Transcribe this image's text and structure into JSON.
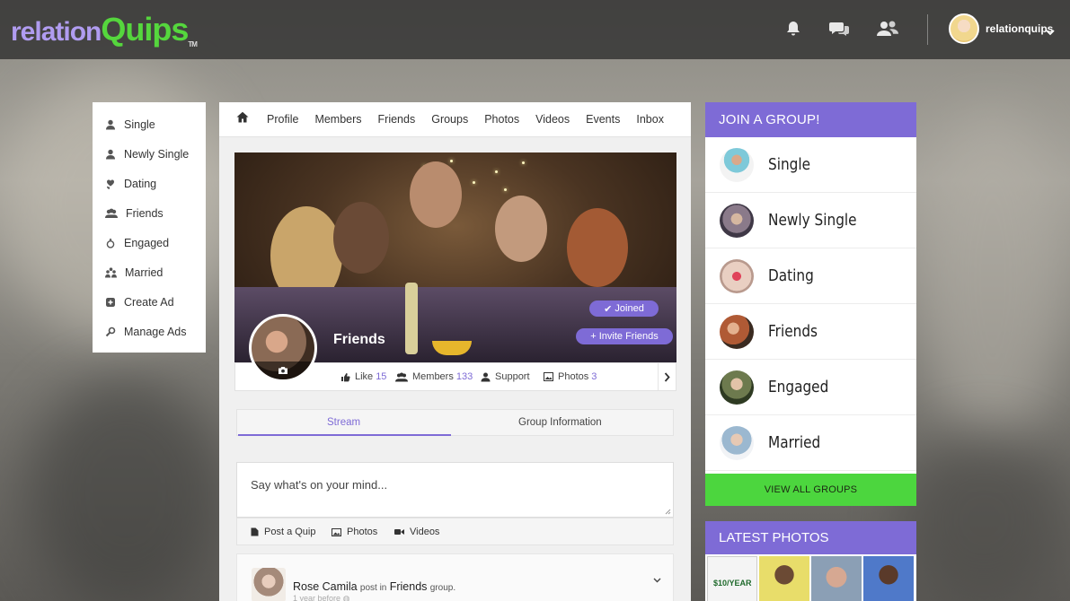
{
  "header": {
    "logo_part1": "relation",
    "logo_part2": "Quips",
    "logo_tm": "TM",
    "username": "relationquips",
    "icons": [
      "bell-icon",
      "chat-icon",
      "friends-icon"
    ]
  },
  "left_menu": {
    "items": [
      {
        "label": "Single",
        "icon": "single-user-icon"
      },
      {
        "label": "Newly Single",
        "icon": "newly-single-icon"
      },
      {
        "label": "Dating",
        "icon": "dating-icon"
      },
      {
        "label": "Friends",
        "icon": "friends-group-icon"
      },
      {
        "label": "Engaged",
        "icon": "ring-icon"
      },
      {
        "label": "Married",
        "icon": "couple-icon"
      },
      {
        "label": "Create Ad",
        "icon": "plus-square-icon"
      },
      {
        "label": "Manage Ads",
        "icon": "settings-icon"
      }
    ]
  },
  "nav": {
    "items": [
      "Profile",
      "Members",
      "Friends",
      "Groups",
      "Photos",
      "Videos",
      "Events",
      "Inbox"
    ]
  },
  "group": {
    "name": "Friends",
    "joined_label": "Joined",
    "invite_label": "Invite Friends",
    "stats": {
      "like_label": "Like",
      "like_count": "15",
      "members_label": "Members",
      "members_count": "133",
      "support_label": "Support",
      "photos_label": "Photos",
      "photos_count": "3"
    }
  },
  "tabs": {
    "stream": "Stream",
    "info": "Group Information"
  },
  "composer": {
    "placeholder": "Say what's on your mind...",
    "actions": [
      "Post a Quip",
      "Photos",
      "Videos"
    ]
  },
  "post": {
    "author": "Rose Camila",
    "mid": "post in",
    "group": "Friends",
    "suffix": "group.",
    "time": "1 year before"
  },
  "right": {
    "join_title": "JOIN A GROUP!",
    "groups": [
      "Single",
      "Newly Single",
      "Dating",
      "Friends",
      "Engaged",
      "Married"
    ],
    "view_all": "VIEW ALL GROUPS",
    "latest_title": "LATEST PHOTOS",
    "ad_thumb_text": "$10/YEAR"
  },
  "colors": {
    "accent_purple": "#7e6bd6",
    "accent_green": "#4cd63e"
  }
}
